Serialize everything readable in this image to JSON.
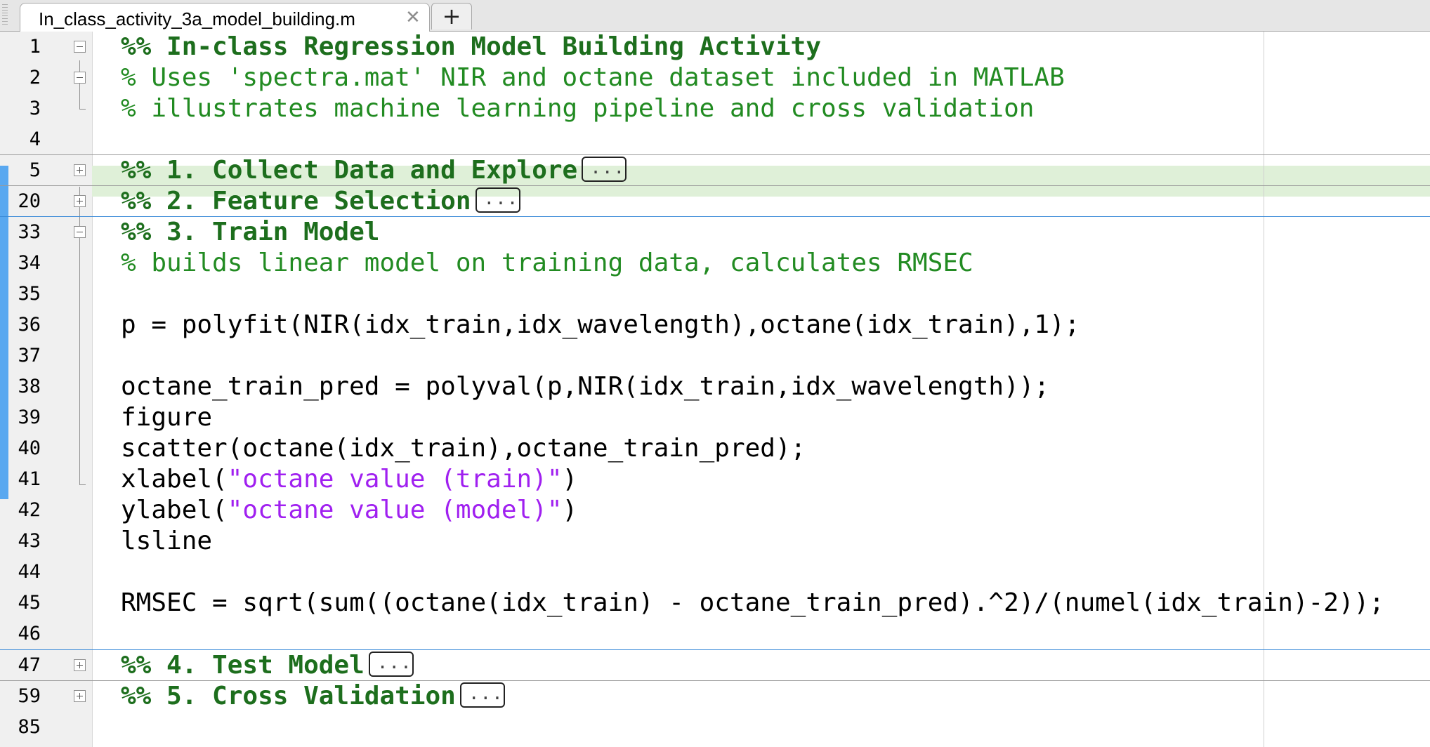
{
  "tab": {
    "title": "In_class_activity_3a_model_building.m",
    "close_glyph": "✕",
    "new_tab_glyph": "+"
  },
  "editor": {
    "lines": [
      {
        "n": "1",
        "text": "%% In-class Regression Model Building Activity"
      },
      {
        "n": "2",
        "text": "% Uses 'spectra.mat' NIR and octane dataset included in MATLAB"
      },
      {
        "n": "3",
        "text": "% illustrates machine learning pipeline and cross validation"
      },
      {
        "n": "4",
        "text": ""
      },
      {
        "n": "5",
        "text": "%% 1. Collect Data and Explore"
      },
      {
        "n": "20",
        "text": "%% 2. Feature Selection"
      },
      {
        "n": "33",
        "text": "%% 3. Train Model"
      },
      {
        "n": "34",
        "text": "% builds linear model on training data, calculates RMSEC"
      },
      {
        "n": "35",
        "text": ""
      },
      {
        "n": "36",
        "text": "p = polyfit(NIR(idx_train,idx_wavelength),octane(idx_train),1);"
      },
      {
        "n": "37",
        "text": ""
      },
      {
        "n": "38",
        "text": "octane_train_pred = polyval(p,NIR(idx_train,idx_wavelength));"
      },
      {
        "n": "39",
        "text": "figure"
      },
      {
        "n": "40",
        "text": "scatter(octane(idx_train),octane_train_pred);"
      },
      {
        "n": "41",
        "code": "xlabel(",
        "str": "\"octane value (train)\"",
        "tail": ")"
      },
      {
        "n": "42",
        "code": "ylabel(",
        "str": "\"octane value (model)\"",
        "tail": ")"
      },
      {
        "n": "43",
        "text": "lsline"
      },
      {
        "n": "44",
        "text": ""
      },
      {
        "n": "45",
        "text": "RMSEC = sqrt(sum((octane(idx_train) - octane_train_pred).^2)/(numel(idx_train)-2));"
      },
      {
        "n": "46",
        "text": ""
      },
      {
        "n": "47",
        "text": "%% 4. Test Model"
      },
      {
        "n": "59",
        "text": "%% 5. Cross Validation"
      },
      {
        "n": "85",
        "text": ""
      }
    ]
  },
  "colors": {
    "comment": "#228b22",
    "section": "#1d6e1d",
    "string": "#a020f0",
    "active_section_bg": "#dff0d8",
    "active_bar": "#59a8f0"
  }
}
